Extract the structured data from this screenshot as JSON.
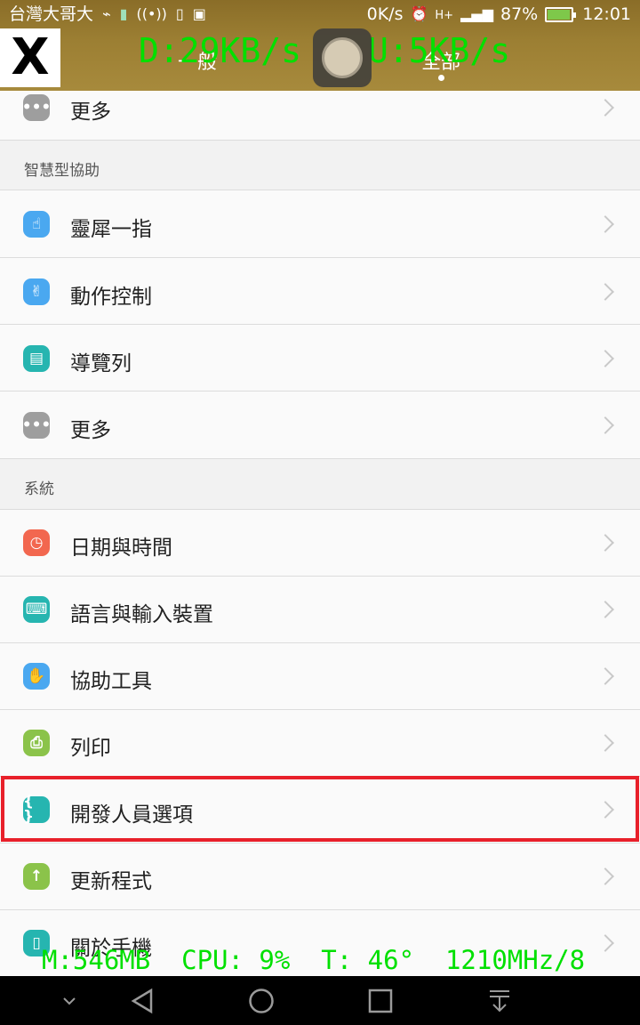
{
  "status_bar": {
    "carrier": "台灣大哥大",
    "net_speed": "0K/s",
    "network": "H+",
    "battery_percent": "87%",
    "battery_level": 0.87,
    "time": "12:01"
  },
  "tabs": {
    "general": "一般",
    "all": "全部",
    "selected": "all"
  },
  "overlay": {
    "download": "D:29KB/s",
    "upload": "U:5KB/s",
    "stats": "M:546MB  CPU: 9%  T: 46°  1210MHz/8",
    "close_glyph": "X"
  },
  "list": {
    "top_more": {
      "label": "更多",
      "icon": "more-icon",
      "color": "#9e9e9e"
    },
    "section_assist": "智慧型協助",
    "assist_items": [
      {
        "label": "靈犀一指",
        "icon": "finger-touch-icon",
        "color": "#4aa8f0"
      },
      {
        "label": "動作控制",
        "icon": "gesture-hand-icon",
        "color": "#4aa8f0"
      },
      {
        "label": "導覽列",
        "icon": "navigation-bar-icon",
        "color": "#26b5b0"
      },
      {
        "label": "更多",
        "icon": "more-icon",
        "color": "#9e9e9e"
      }
    ],
    "section_system": "系統",
    "system_items": [
      {
        "label": "日期與時間",
        "icon": "clock-icon",
        "color": "#f2674f"
      },
      {
        "label": "語言與輸入裝置",
        "icon": "keyboard-icon",
        "color": "#26b5b0"
      },
      {
        "label": "協助工具",
        "icon": "accessibility-hand-icon",
        "color": "#4aa8f0"
      },
      {
        "label": "列印",
        "icon": "printer-icon",
        "color": "#8bc34a"
      },
      {
        "label": "開發人員選項",
        "icon": "developer-braces-icon",
        "color": "#26b5b0"
      },
      {
        "label": "更新程式",
        "icon": "update-arrow-icon",
        "color": "#8bc34a"
      },
      {
        "label": "關於手機",
        "icon": "phone-icon",
        "color": "#26b5b0"
      }
    ],
    "highlighted_item": "開發人員選項"
  },
  "nav_bar": {
    "buttons": [
      "collapse-icon",
      "back-icon",
      "home-icon",
      "recents-icon",
      "notification-pull-icon"
    ]
  }
}
